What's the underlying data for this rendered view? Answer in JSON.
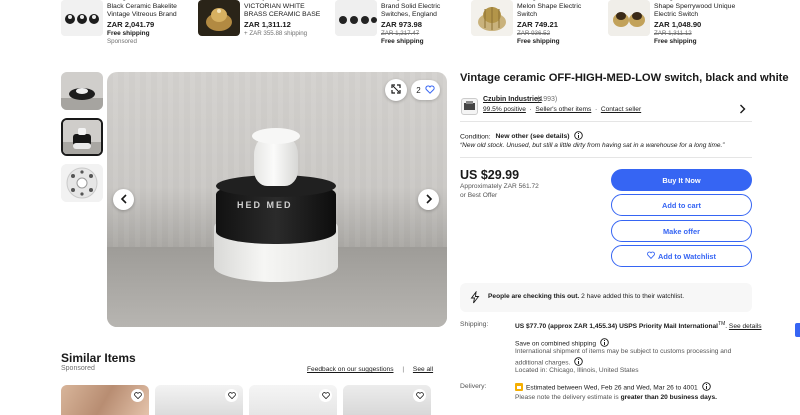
{
  "carousel": [
    {
      "title": "Vintage Bakelite Switches Black Ceramic Bakelite Vintage Vitreous Brand England",
      "price": "ZAR 2,041.79",
      "old_price": "",
      "shipping": "Free shipping",
      "sub": "Sponsored"
    },
    {
      "title": "ANTIQUE OLD VINTAGE VICTORIAN WHITE BRASS CERAMIC BASE ELECTRIC...",
      "price": "ZAR 1,311.12",
      "old_price": "",
      "shipping": "",
      "sub": "+ ZAR 355.88 shipping"
    },
    {
      "title": "Vintage Ceramic Vitreous Brand Solid Electric Switches, England",
      "price": "ZAR 973.98",
      "old_price": "ZAR 1,217.47",
      "shipping": "Free shipping",
      "sub": ""
    },
    {
      "title": "Vintage Brass Ceramic Melon Shape Electric Switch",
      "price": "ZAR 749.21",
      "old_price": "ZAR 936.52",
      "shipping": "Free shipping",
      "sub": ""
    },
    {
      "title": "Vintage Brass Ceramic Melon Shape Sperrywood Unique Electric Switch",
      "price": "ZAR 1,048.90",
      "old_price": "ZAR 1,311.12",
      "shipping": "Free shipping",
      "sub": ""
    }
  ],
  "gallery": {
    "watch_count": "2",
    "marks": "HED  MED"
  },
  "listing": {
    "title": "Vintage ceramic OFF-HIGH-MED-LOW switch, black and white",
    "seller_name": "Czubin Industries",
    "seller_count": "(1993)",
    "seller_positive": "99.5% positive",
    "seller_other": "Seller's other items",
    "seller_contact": "Contact seller",
    "condition_label": "Condition:",
    "condition_value": "New other (see details)",
    "condition_desc": "“New old stock. Unused, but still a little dirty from having sat in a warehouse for a long time.”",
    "price": "US $29.99",
    "approx": "Approximately ZAR 561.72",
    "best_offer": "or Best Offer"
  },
  "buttons": {
    "buy": "Buy It Now",
    "cart": "Add to cart",
    "offer": "Make offer",
    "watch": "Add to Watchlist"
  },
  "notice": {
    "bold": "People are checking this out.",
    "rest": " 2 have added this to their watchlist."
  },
  "shipping": {
    "label": "Shipping:",
    "line1": "US $77.70 (approx ZAR 1,455.34) USPS Priority Mail International",
    "tm": "TM",
    "see_details": "See details",
    "combined": "Save on combined shipping",
    "intl1": "International shipment of items may be subject to customs processing and",
    "intl2": "additional charges.",
    "located": "Located in: Chicago, Illinois, United States"
  },
  "delivery": {
    "label": "Delivery:",
    "estimated": "Estimated between Wed, Feb 26 and Wed, Mar 26 to 4001",
    "note_prefix": "Please note the delivery estimate is ",
    "note_bold": "greater than 20 business days."
  },
  "similar": {
    "title": "Similar Items",
    "sub": "Sponsored",
    "feedback": "Feedback on our suggestions",
    "sep": "|",
    "see_all": "See all"
  },
  "colors": {
    "accent": "#3665f3",
    "text": "#191919",
    "muted": "#707070"
  }
}
